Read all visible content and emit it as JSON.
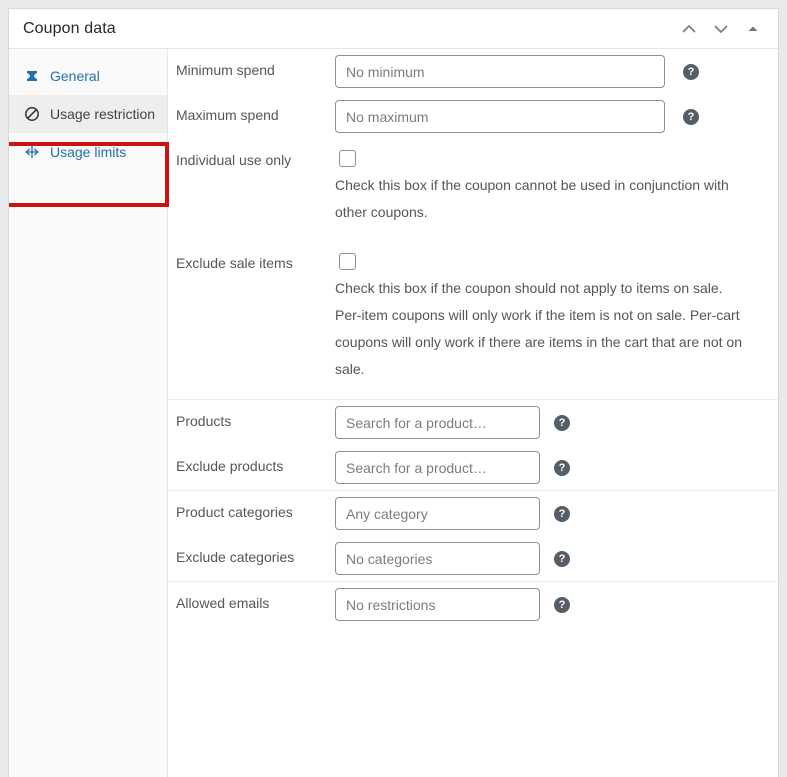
{
  "panel": {
    "title": "Coupon data",
    "header_actions": [
      {
        "name": "move-up-button",
        "icon": "chevron-up-icon",
        "label": "Move up"
      },
      {
        "name": "move-down-button",
        "icon": "chevron-down-icon",
        "label": "Move down"
      },
      {
        "name": "toggle-panel-button",
        "icon": "triangle-up-icon",
        "label": "Toggle panel"
      }
    ]
  },
  "sidebar": {
    "items": [
      {
        "label": "General",
        "icon": "coupon-ticket-icon",
        "active": false
      },
      {
        "label": "Usage restriction",
        "icon": "prohibition-icon",
        "active": true
      },
      {
        "label": "Usage limits",
        "icon": "usage-limits-icon",
        "active": false
      }
    ]
  },
  "annotation": {
    "target": "Usage restriction",
    "border_color": "#cc1111"
  },
  "colors": {
    "link": "#2271b1",
    "label": "#50575e",
    "title": "#23282d",
    "active_tab_bg": "#eeeeee",
    "input_border": "#8c8f94",
    "help_bg": "#555d66",
    "panel_bg": "#ffffff",
    "page_bg": "#e8e9ea"
  },
  "fields": {
    "minimum_spend": {
      "label": "Minimum spend",
      "value": "",
      "placeholder": "No minimum",
      "help": "?"
    },
    "maximum_spend": {
      "label": "Maximum spend",
      "value": "",
      "placeholder": "No maximum",
      "help": "?"
    },
    "individual_use_only": {
      "label": "Individual use only",
      "checked": false,
      "description": "Check this box if the coupon cannot be used in conjunction with other coupons."
    },
    "exclude_sale_items": {
      "label": "Exclude sale items",
      "checked": false,
      "description": "Check this box if the coupon should not apply to items on sale. Per-item coupons will only work if the item is not on sale. Per-cart coupons will only work if there are items in the cart that are not on sale."
    },
    "products": {
      "label": "Products",
      "value": "",
      "placeholder": "Search for a product…",
      "help": "?"
    },
    "exclude_products": {
      "label": "Exclude products",
      "value": "",
      "placeholder": "Search for a product…",
      "help": "?"
    },
    "product_categories": {
      "label": "Product categories",
      "value": "",
      "placeholder": "Any category",
      "help": "?"
    },
    "exclude_categories": {
      "label": "Exclude categories",
      "value": "",
      "placeholder": "No categories",
      "help": "?"
    },
    "allowed_emails": {
      "label": "Allowed emails",
      "value": "",
      "placeholder": "No restrictions",
      "help": "?"
    }
  }
}
